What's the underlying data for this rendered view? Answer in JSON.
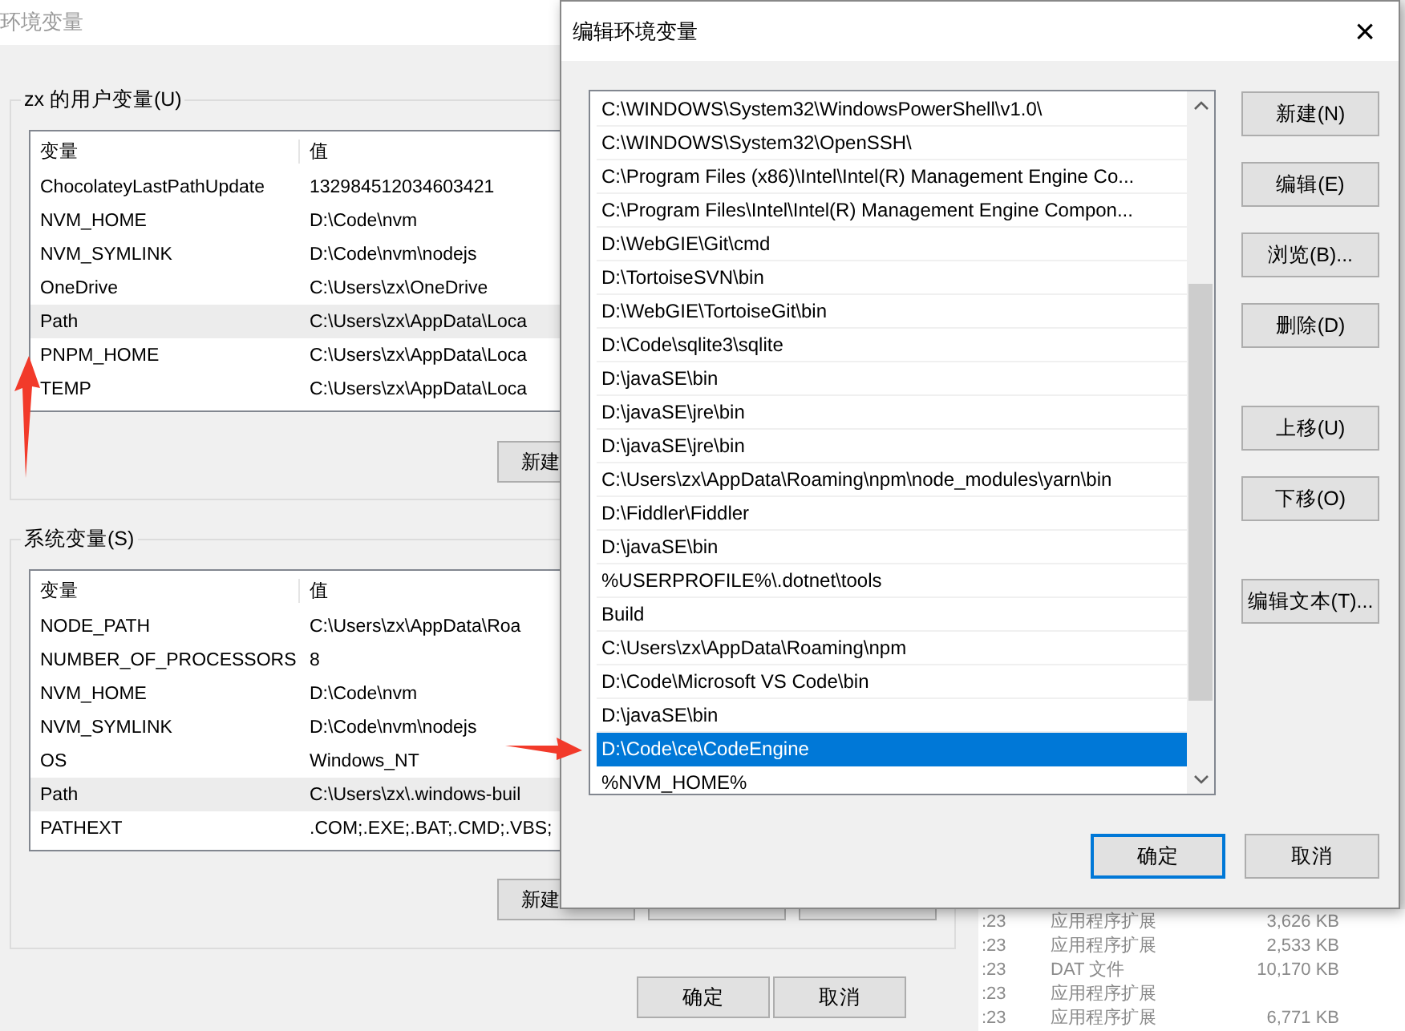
{
  "background_window": {
    "title": "环境变量",
    "user_group": {
      "title": "zx 的用户变量(U)",
      "columns": [
        "变量",
        "值"
      ],
      "rows": [
        {
          "name": "ChocolateyLastPathUpdate",
          "value": "132984512034603421",
          "selected": false
        },
        {
          "name": "NVM_HOME",
          "value": "D:\\Code\\nvm",
          "selected": false
        },
        {
          "name": "NVM_SYMLINK",
          "value": "D:\\Code\\nvm\\nodejs",
          "selected": false
        },
        {
          "name": "OneDrive",
          "value": "C:\\Users\\zx\\OneDrive",
          "selected": false
        },
        {
          "name": "Path",
          "value": "C:\\Users\\zx\\AppData\\Loca",
          "selected": true
        },
        {
          "name": "PNPM_HOME",
          "value": "C:\\Users\\zx\\AppData\\Loca",
          "selected": false
        },
        {
          "name": "TEMP",
          "value": "C:\\Users\\zx\\AppData\\Loca",
          "selected": false
        }
      ],
      "buttons": [
        "新建"
      ]
    },
    "system_group": {
      "title": "系统变量(S)",
      "columns": [
        "变量",
        "值"
      ],
      "rows": [
        {
          "name": "NODE_PATH",
          "value": "C:\\Users\\zx\\AppData\\Roa",
          "selected": false
        },
        {
          "name": "NUMBER_OF_PROCESSORS",
          "value": "8",
          "selected": false
        },
        {
          "name": "NVM_HOME",
          "value": "D:\\Code\\nvm",
          "selected": false
        },
        {
          "name": "NVM_SYMLINK",
          "value": "D:\\Code\\nvm\\nodejs",
          "selected": false
        },
        {
          "name": "OS",
          "value": "Windows_NT",
          "selected": false
        },
        {
          "name": "Path",
          "value": "C:\\Users\\zx\\.windows-buil",
          "selected": true
        },
        {
          "name": "PATHEXT",
          "value": ".COM;.EXE;.BAT;.CMD;.VBS;",
          "selected": false
        }
      ],
      "buttons": [
        "新建"
      ]
    },
    "buttons": [
      "确定",
      "取消"
    ]
  },
  "edit_dialog": {
    "title": "编辑环境变量",
    "close": "×",
    "entries": [
      {
        "text": "C:\\WINDOWS\\System32\\WindowsPowerShell\\v1.0\\",
        "selected": false
      },
      {
        "text": "C:\\WINDOWS\\System32\\OpenSSH\\",
        "selected": false
      },
      {
        "text": "C:\\Program Files (x86)\\Intel\\Intel(R) Management Engine Co...",
        "selected": false
      },
      {
        "text": "C:\\Program Files\\Intel\\Intel(R) Management Engine Compon...",
        "selected": false
      },
      {
        "text": "D:\\WebGIE\\Git\\cmd",
        "selected": false
      },
      {
        "text": "D:\\TortoiseSVN\\bin",
        "selected": false
      },
      {
        "text": "D:\\WebGIE\\TortoiseGit\\bin",
        "selected": false
      },
      {
        "text": "D:\\Code\\sqlite3\\sqlite",
        "selected": false
      },
      {
        "text": "D:\\javaSE\\bin",
        "selected": false
      },
      {
        "text": "D:\\javaSE\\jre\\bin",
        "selected": false
      },
      {
        "text": "D:\\javaSE\\jre\\bin",
        "selected": false
      },
      {
        "text": "C:\\Users\\zx\\AppData\\Roaming\\npm\\node_modules\\yarn\\bin",
        "selected": false
      },
      {
        "text": "D:\\Fiddler\\Fiddler",
        "selected": false
      },
      {
        "text": "D:\\javaSE\\bin",
        "selected": false
      },
      {
        "text": "%USERPROFILE%\\.dotnet\\tools",
        "selected": false
      },
      {
        "text": "Build",
        "selected": false
      },
      {
        "text": "C:\\Users\\zx\\AppData\\Roaming\\npm",
        "selected": false
      },
      {
        "text": "D:\\Code\\Microsoft VS Code\\bin",
        "selected": false
      },
      {
        "text": "D:\\javaSE\\bin",
        "selected": false
      },
      {
        "text": "D:\\Code\\ce\\CodeEngine",
        "selected": true
      },
      {
        "text": "%NVM_HOME%",
        "selected": false
      }
    ],
    "buttons": [
      {
        "label": "新建(N)",
        "kind": "top"
      },
      {
        "label": "编辑(E)",
        "kind": "top"
      },
      {
        "label": "浏览(B)...",
        "kind": "top"
      },
      {
        "label": "删除(D)",
        "kind": "top"
      },
      {
        "label": "上移(U)",
        "kind": "gap"
      },
      {
        "label": "下移(O)",
        "kind": "top"
      },
      {
        "label": "编辑文本(T)...",
        "kind": "gap"
      }
    ],
    "footer_buttons": [
      {
        "label": "确定",
        "default": true
      },
      {
        "label": "取消",
        "default": false
      }
    ]
  },
  "file_list": {
    "rows": [
      {
        "time": ":23",
        "type": "应用程序扩展",
        "size": "3,626 KB"
      },
      {
        "time": ":23",
        "type": "应用程序扩展",
        "size": "2,533 KB"
      },
      {
        "time": ":23",
        "type": "DAT 文件",
        "size": "10,170 KB"
      },
      {
        "time": ":23",
        "type": "应用程序扩展"
      },
      {
        "time": ":23",
        "type": "应用程序扩展",
        "size": "6,771 KB"
      }
    ]
  }
}
